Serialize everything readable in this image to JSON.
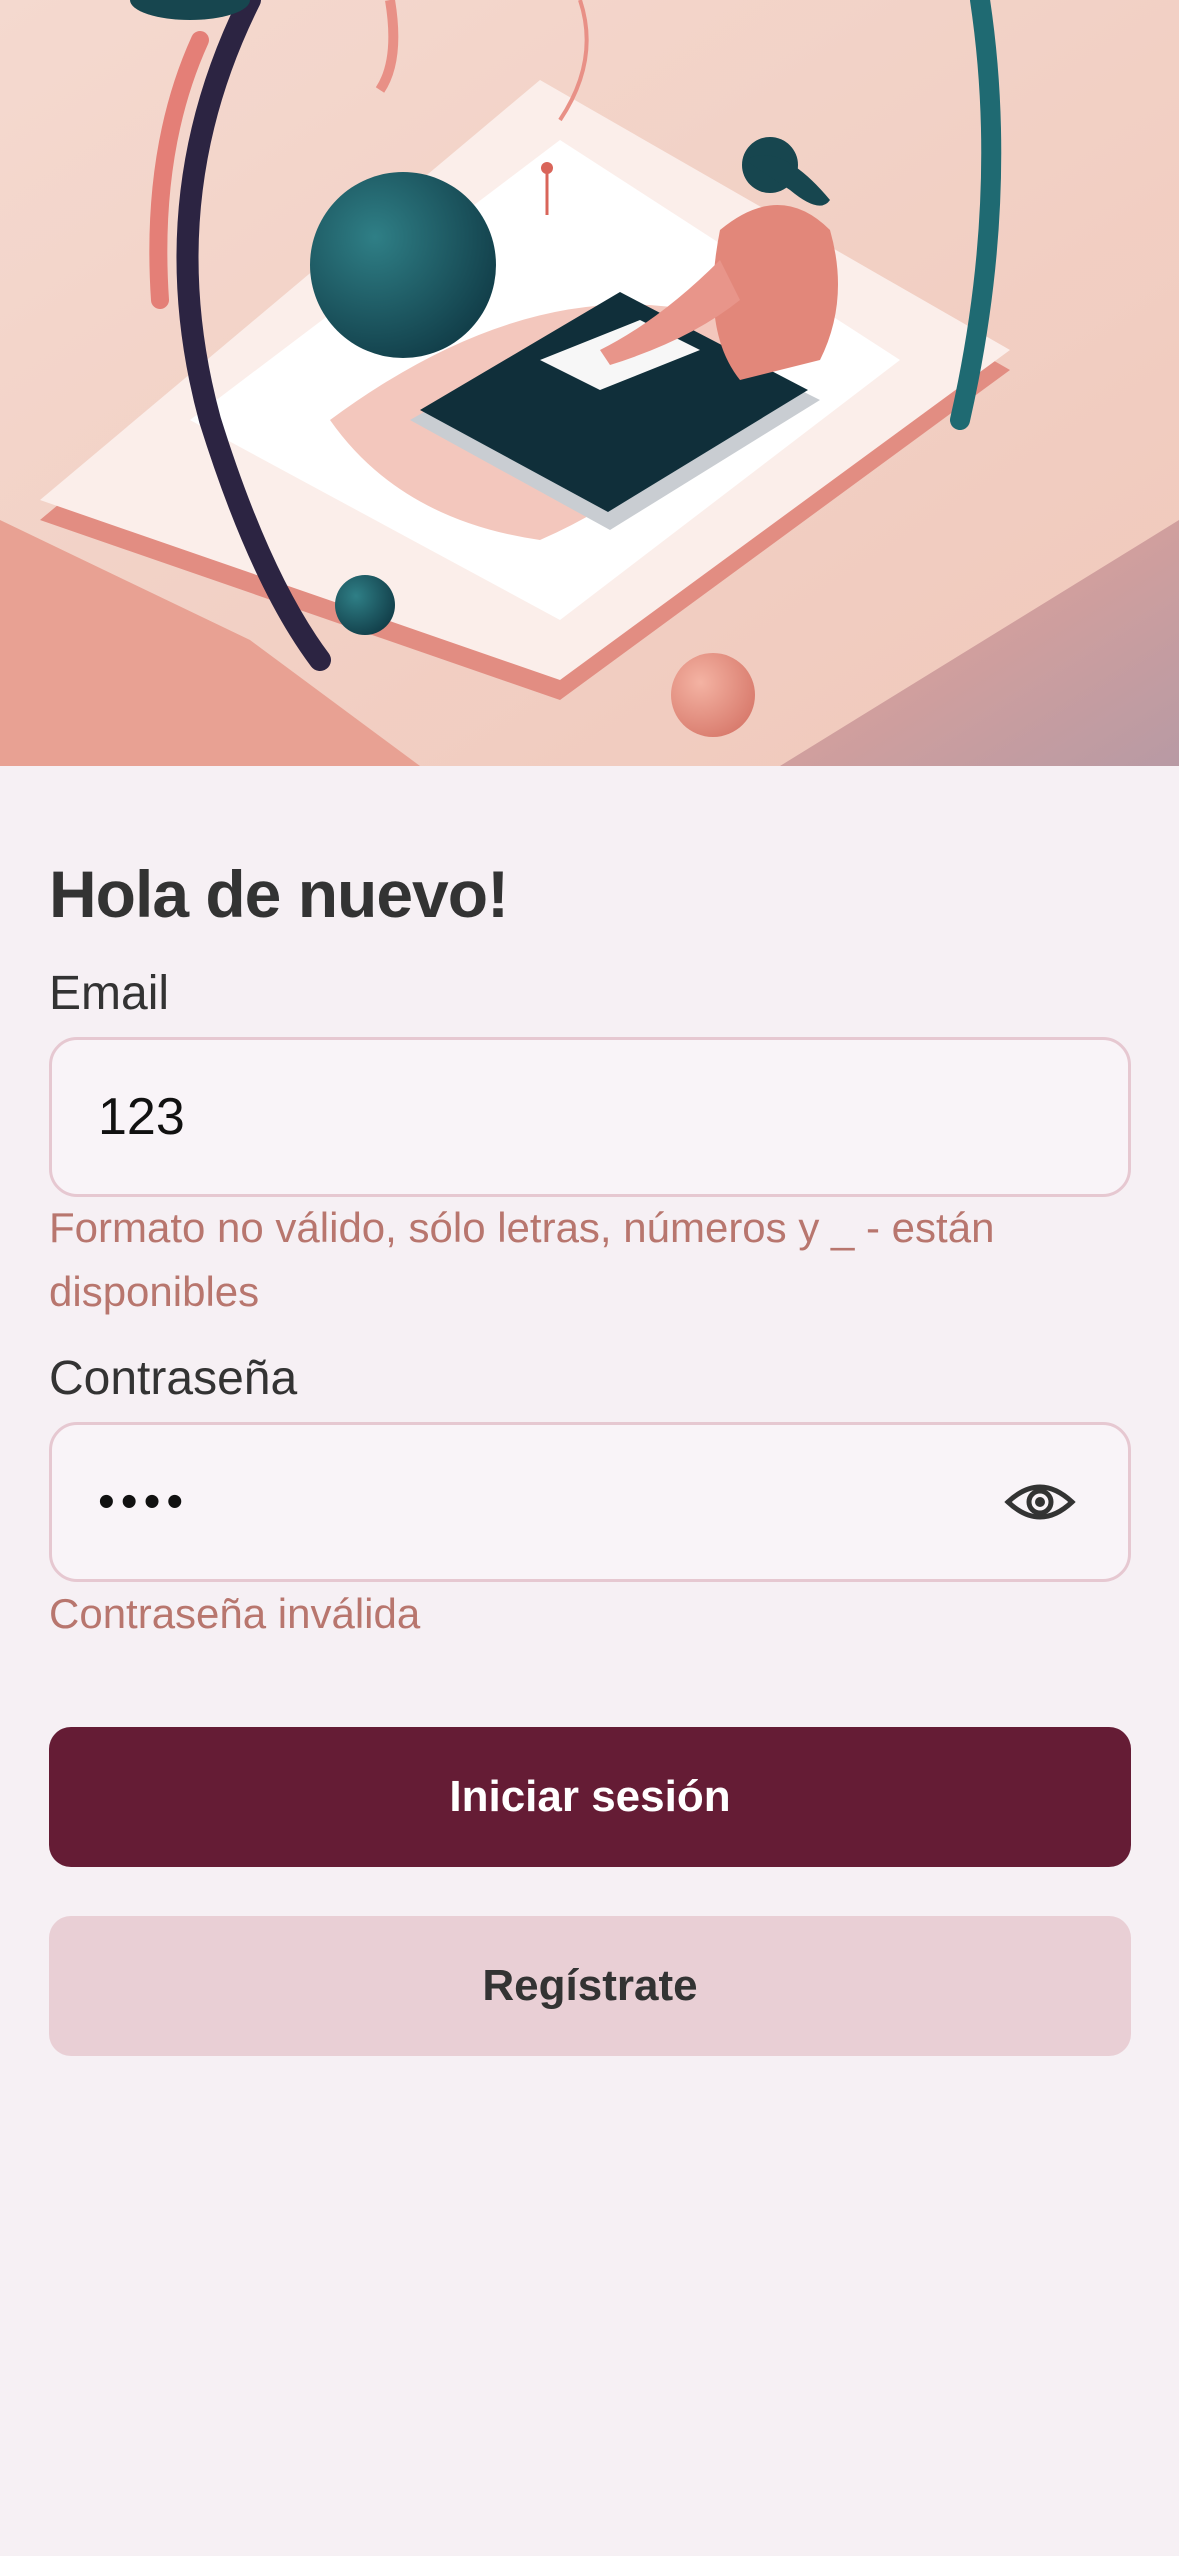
{
  "hero": {
    "image": "illustration-person-using-phone"
  },
  "login": {
    "title": "Hola de nuevo!",
    "email_label": "Email",
    "email_value": "123",
    "email_error": "Formato no válido, sólo letras, números y _ - están disponibles",
    "password_label": "Contraseña",
    "password_value": "••••",
    "password_error": "Contraseña inválida",
    "login_button": "Iniciar sesión",
    "register_button": "Regístrate"
  },
  "icons": {
    "password_toggle": "eye-icon"
  },
  "colors": {
    "background": "#f6f0f4",
    "primary": "#651c35",
    "secondary": "#e9cfd5",
    "error": "#b8766e",
    "field_border": "#e6c8d1"
  }
}
